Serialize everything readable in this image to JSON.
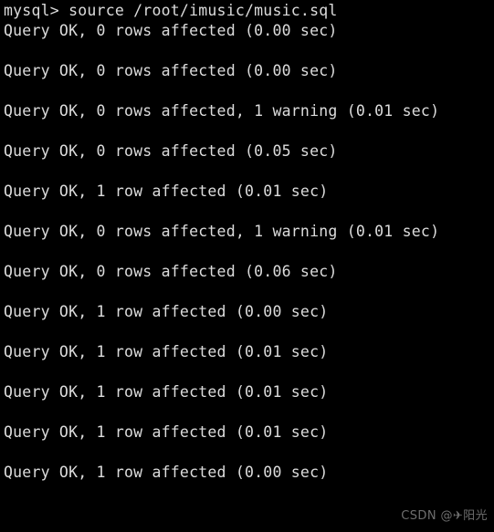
{
  "terminal": {
    "background_color": "#000000",
    "text_color": "#dcdcdc",
    "prompt": "mysql>",
    "command": "source /root/imusic/music.sql",
    "lines": [
      {
        "text": "mysql> source /root/imusic/music.sql",
        "kind": "prompt"
      },
      {
        "text": "Query OK, 0 rows affected (0.00 sec)",
        "kind": "result"
      },
      {
        "text": "",
        "kind": "blank"
      },
      {
        "text": "Query OK, 0 rows affected (0.00 sec)",
        "kind": "result"
      },
      {
        "text": "",
        "kind": "blank"
      },
      {
        "text": "Query OK, 0 rows affected, 1 warning (0.01 sec)",
        "kind": "result"
      },
      {
        "text": "",
        "kind": "blank"
      },
      {
        "text": "Query OK, 0 rows affected (0.05 sec)",
        "kind": "result"
      },
      {
        "text": "",
        "kind": "blank"
      },
      {
        "text": "Query OK, 1 row affected (0.01 sec)",
        "kind": "result"
      },
      {
        "text": "",
        "kind": "blank"
      },
      {
        "text": "Query OK, 0 rows affected, 1 warning (0.01 sec)",
        "kind": "result"
      },
      {
        "text": "",
        "kind": "blank"
      },
      {
        "text": "Query OK, 0 rows affected (0.06 sec)",
        "kind": "result"
      },
      {
        "text": "",
        "kind": "blank"
      },
      {
        "text": "Query OK, 1 row affected (0.00 sec)",
        "kind": "result"
      },
      {
        "text": "",
        "kind": "blank"
      },
      {
        "text": "Query OK, 1 row affected (0.01 sec)",
        "kind": "result"
      },
      {
        "text": "",
        "kind": "blank"
      },
      {
        "text": "Query OK, 1 row affected (0.01 sec)",
        "kind": "result"
      },
      {
        "text": "",
        "kind": "blank"
      },
      {
        "text": "Query OK, 1 row affected (0.01 sec)",
        "kind": "result"
      },
      {
        "text": "",
        "kind": "blank"
      },
      {
        "text": "Query OK, 1 row affected (0.00 sec)",
        "kind": "result"
      }
    ]
  },
  "watermark": {
    "text": "CSDN @✈阳光",
    "color": "#6e6e6e"
  }
}
